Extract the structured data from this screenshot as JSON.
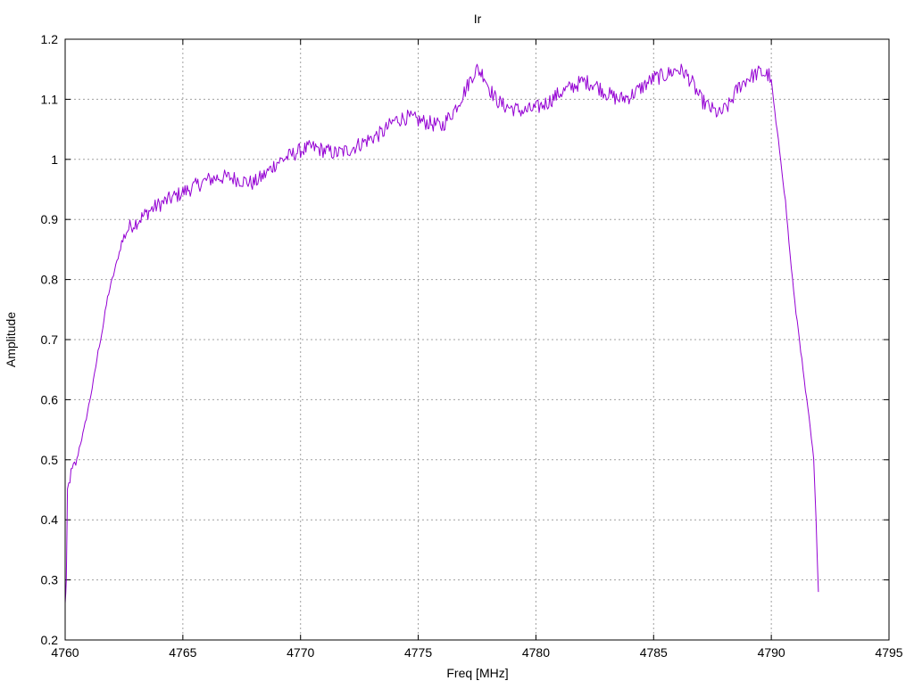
{
  "chart_data": {
    "type": "line",
    "title": "Ir",
    "xlabel": "Freq [MHz]",
    "ylabel": "Amplitude",
    "xlim": [
      4760,
      4795
    ],
    "ylim": [
      0.2,
      1.2
    ],
    "x_ticks": [
      4760,
      4765,
      4770,
      4775,
      4780,
      4785,
      4790,
      4795
    ],
    "x_tick_labels": [
      "4760",
      "4765",
      "4770",
      "4775",
      "4780",
      "4785",
      "4790",
      "4795"
    ],
    "y_ticks": [
      0.2,
      0.3,
      0.4,
      0.5,
      0.6,
      0.7,
      0.8,
      0.9,
      1.0,
      1.1,
      1.2
    ],
    "y_tick_labels": [
      "0.2",
      "0.3",
      "0.4",
      "0.5",
      "0.6",
      "0.7",
      "0.8",
      "0.9",
      "1",
      "1.1",
      "1.2"
    ],
    "grid": true,
    "legend": "none",
    "series": [
      {
        "color": "#9400d3",
        "x": [
          4760.0,
          4760.05,
          4760.1,
          4760.2,
          4760.4,
          4760.5,
          4760.6,
          4760.8,
          4761.0,
          4761.2,
          4761.4,
          4761.6,
          4761.8,
          4762.0,
          4762.2,
          4762.4,
          4762.6,
          4762.8,
          4763.0,
          4763.3,
          4763.6,
          4764.0,
          4764.5,
          4765.0,
          4765.5,
          4766.0,
          4766.5,
          4767.0,
          4767.5,
          4768.0,
          4768.5,
          4769.0,
          4769.5,
          4770.0,
          4770.5,
          4771.0,
          4771.5,
          4772.0,
          4772.5,
          4773.0,
          4773.5,
          4774.0,
          4774.5,
          4775.0,
          4775.5,
          4776.0,
          4776.5,
          4777.0,
          4777.3,
          4777.5,
          4777.8,
          4778.0,
          4778.3,
          4778.6,
          4779.0,
          4779.5,
          4780.0,
          4780.5,
          4781.0,
          4781.5,
          4782.0,
          4782.5,
          4783.0,
          4783.5,
          4784.0,
          4784.5,
          4785.0,
          4785.5,
          4786.0,
          4786.3,
          4786.6,
          4787.0,
          4787.4,
          4787.8,
          4788.2,
          4788.6,
          4789.0,
          4789.5,
          4789.9,
          4790.0,
          4790.2,
          4790.4,
          4790.6,
          4790.8,
          4791.0,
          4791.2,
          4791.4,
          4791.6,
          4791.8,
          4791.9,
          4792.0
        ],
        "y": [
          0.26,
          0.3,
          0.45,
          0.47,
          0.49,
          0.5,
          0.52,
          0.55,
          0.59,
          0.63,
          0.68,
          0.72,
          0.77,
          0.8,
          0.83,
          0.86,
          0.88,
          0.89,
          0.895,
          0.905,
          0.915,
          0.925,
          0.935,
          0.945,
          0.955,
          0.965,
          0.97,
          0.97,
          0.965,
          0.96,
          0.975,
          0.995,
          1.005,
          1.015,
          1.02,
          1.015,
          1.01,
          1.015,
          1.025,
          1.035,
          1.045,
          1.065,
          1.07,
          1.065,
          1.06,
          1.055,
          1.08,
          1.115,
          1.14,
          1.15,
          1.14,
          1.12,
          1.1,
          1.09,
          1.085,
          1.08,
          1.085,
          1.095,
          1.11,
          1.12,
          1.13,
          1.125,
          1.11,
          1.1,
          1.105,
          1.12,
          1.135,
          1.14,
          1.15,
          1.145,
          1.13,
          1.1,
          1.085,
          1.075,
          1.09,
          1.12,
          1.135,
          1.145,
          1.14,
          1.13,
          1.06,
          1.0,
          0.93,
          0.84,
          0.76,
          0.7,
          0.63,
          0.57,
          0.5,
          0.4,
          0.28
        ]
      }
    ]
  }
}
